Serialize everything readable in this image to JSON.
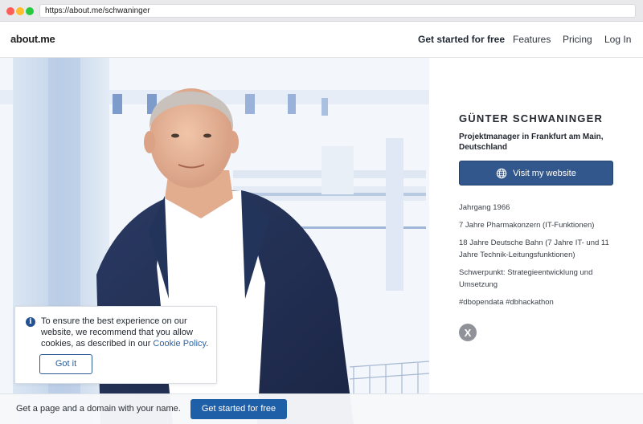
{
  "browser": {
    "url": "https://about.me/schwaninger"
  },
  "nav": {
    "logo": "about.me",
    "cta": "Get started for free",
    "features": "Features",
    "pricing": "Pricing",
    "login": "Log In"
  },
  "profile": {
    "name": "GÜNTER SCHWANINGER",
    "headline": "Projektmanager in Frankfurt am Main, Deutschland",
    "visit_button": "Visit my website",
    "visit_icon": "globe-icon",
    "bio": [
      "Jahrgang 1966",
      "7 Jahre Pharmakonzern (IT-Funktionen)",
      "18 Jahre Deutsche Bahn (7 Jahre IT- und 11 Jahre Technik-Leitungsfunktionen)",
      "Schwerpunkt: Strategieentwicklung und Umsetzung",
      "#dbopendata #dbhackathon"
    ],
    "social_icon": "x-twitter-icon",
    "social_glyph": "X"
  },
  "cookie": {
    "text": "To ensure the best experience on our website, we recommend that you allow cookies, as described in our ",
    "link": "Cookie Policy",
    "suffix": ".",
    "button": "Got it",
    "info_glyph": "i"
  },
  "bottom": {
    "text": "Get a page and a domain with your name.",
    "cta": "Get started for free"
  },
  "colors": {
    "primary_button": "#32578c",
    "bottom_cta": "#1f5fa8",
    "link": "#2d63a6"
  }
}
